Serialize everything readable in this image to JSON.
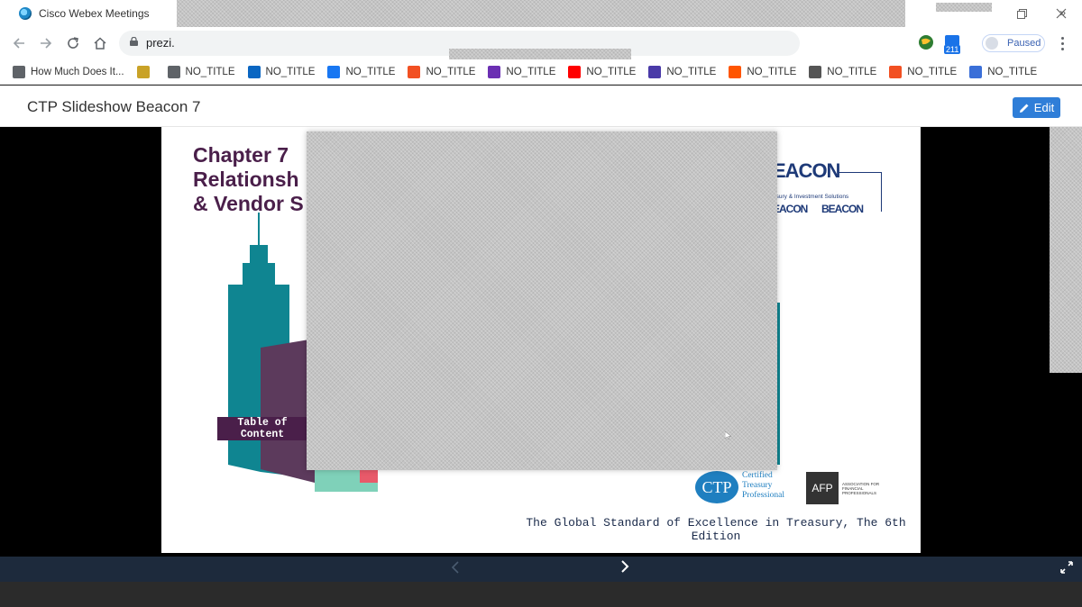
{
  "window": {
    "title": "Cisco Webex Meetings"
  },
  "browser": {
    "url_visible": "prezi.",
    "badge_count": "211",
    "profile_status": "Paused"
  },
  "bookmarks": [
    {
      "label": "How Much Does It...",
      "icon": "globe-icon",
      "color": "#5f6368"
    },
    {
      "label": "",
      "icon": "egypt-flag-icon",
      "color": "#c9a227"
    },
    {
      "label": "NO_TITLE",
      "icon": "globe-icon",
      "color": "#5f6368"
    },
    {
      "label": "NO_TITLE",
      "icon": "linkedin-icon",
      "color": "#0a66c2"
    },
    {
      "label": "NO_TITLE",
      "icon": "facebook-icon",
      "color": "#1877f2"
    },
    {
      "label": "NO_TITLE",
      "icon": "microsoft-icon",
      "color": "#f25022"
    },
    {
      "label": "NO_TITLE",
      "icon": "mail-icon",
      "color": "#6b2fb3"
    },
    {
      "label": "NO_TITLE",
      "icon": "youtube-icon",
      "color": "#ff0000"
    },
    {
      "label": "NO_TITLE",
      "icon": "world-icon",
      "color": "#4a3aa8"
    },
    {
      "label": "NO_TITLE",
      "icon": "soundcloud-icon",
      "color": "#ff5500"
    },
    {
      "label": "NO_TITLE",
      "icon": "apple-icon",
      "color": "#555555"
    },
    {
      "label": "NO_TITLE",
      "icon": "microsoft-icon",
      "color": "#f25022"
    },
    {
      "label": "NO_TITLE",
      "icon": "mail-check-icon",
      "color": "#3a6fd8"
    }
  ],
  "page": {
    "title": "CTP Slideshow Beacon 7",
    "edit_label": "Edit"
  },
  "slide": {
    "heading_lines": [
      "Chapter 7",
      "Relationsh",
      "& Vendor S"
    ],
    "toc_label": [
      "Table of",
      "Content"
    ],
    "logo_text": "EACON",
    "logo_sub": "asury & Investment Solutions",
    "logo_small": [
      "EACON",
      "BEACON"
    ],
    "ctp_badge": {
      "mark": "CTP",
      "lines": [
        "Certified",
        "Treasury",
        "Professional"
      ]
    },
    "afp_badge": {
      "mark": "AFP",
      "lines": [
        "ASSOCIATION FOR",
        "FINANCIAL",
        "PROFESSIONALS"
      ]
    },
    "tagline": "The Global Standard of Excellence in Treasury, The 6th Edition"
  },
  "colors": {
    "accent": "#2f7ed8",
    "teal": "#0f8591",
    "plum": "#4a1f4a",
    "navbar": "#1d2a3c"
  }
}
